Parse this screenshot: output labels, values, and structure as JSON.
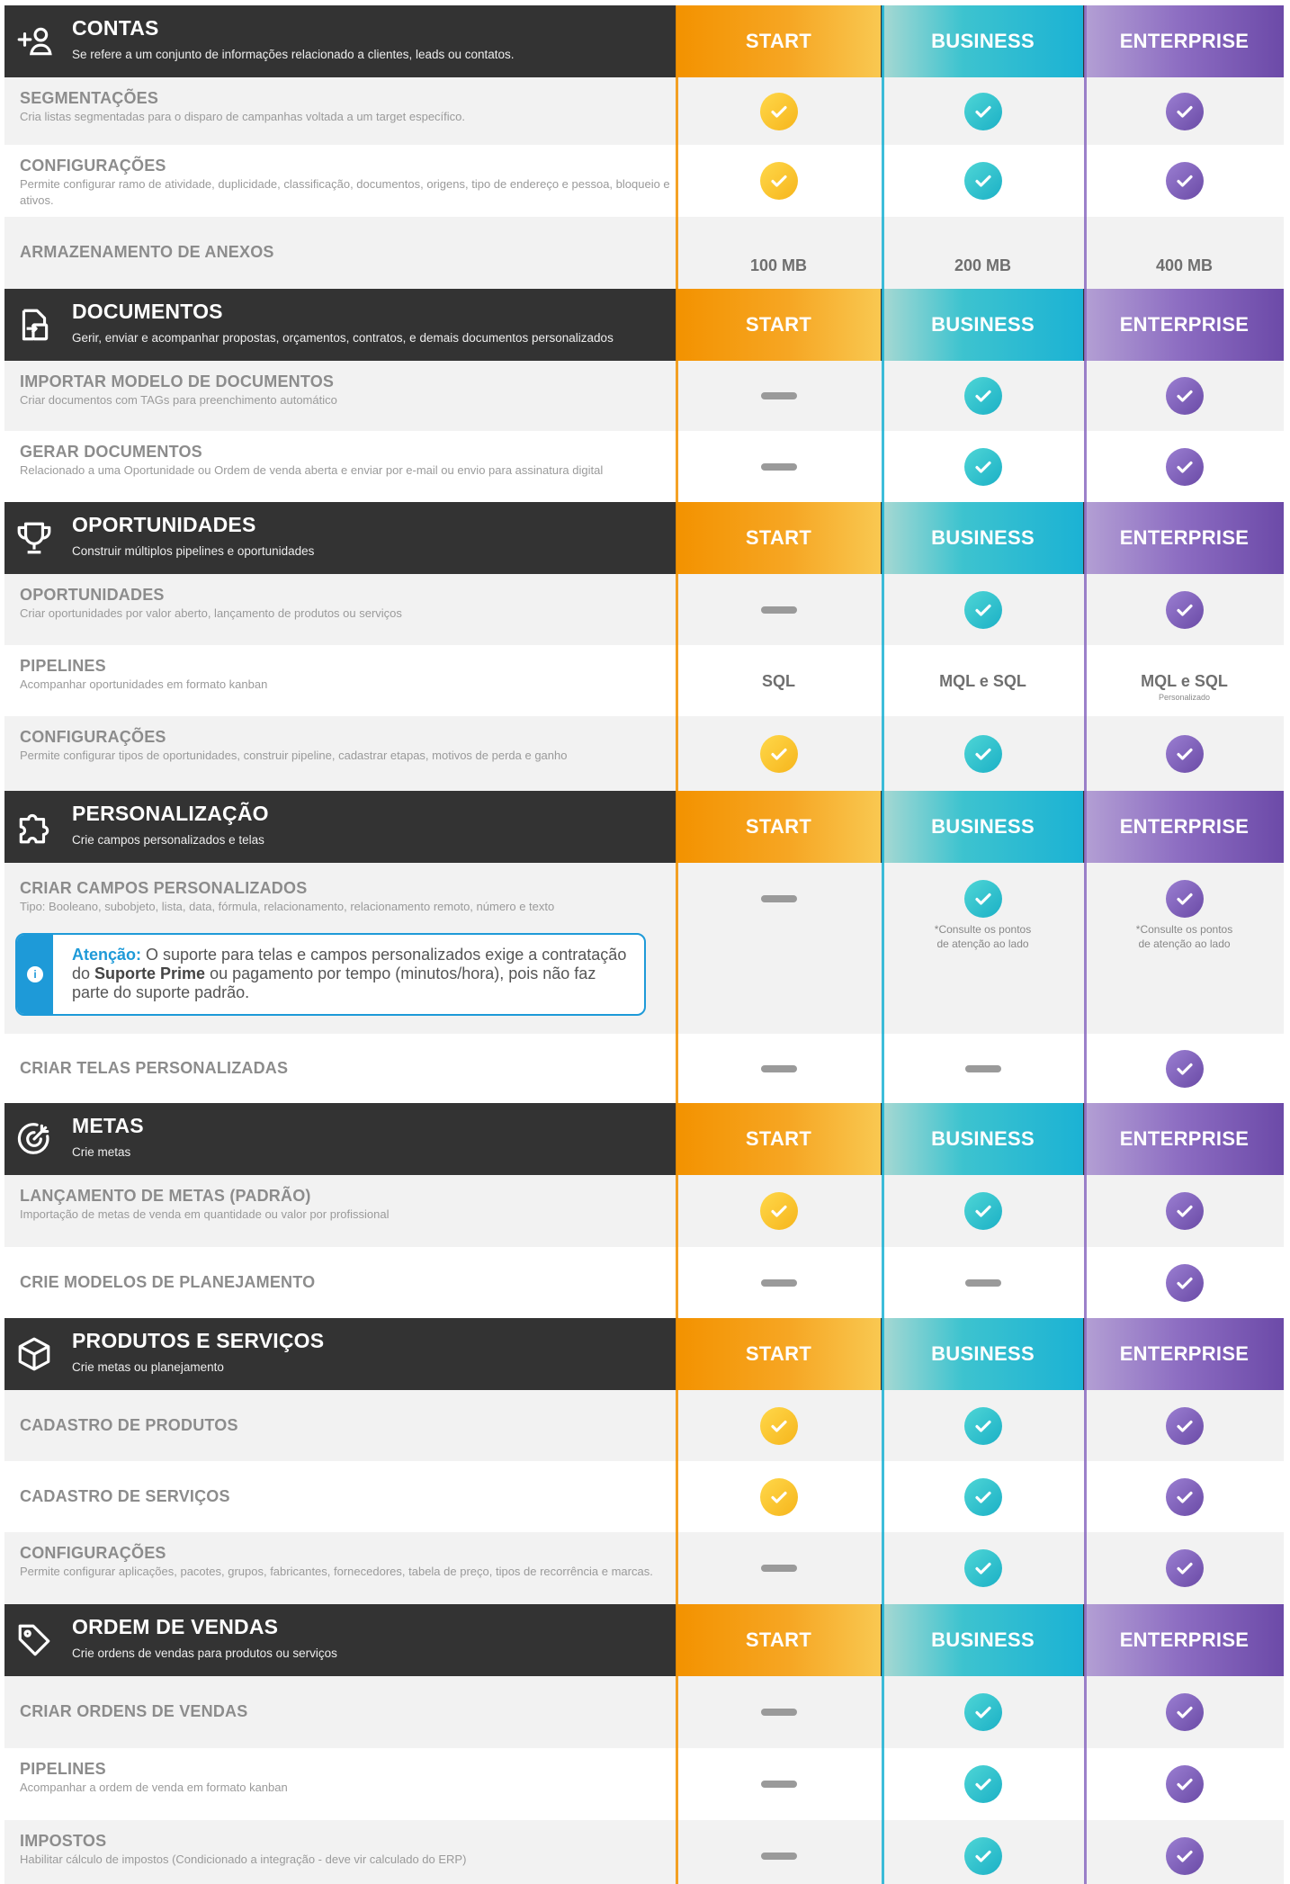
{
  "plans": [
    "START",
    "BUSINESS",
    "ENTERPRISE"
  ],
  "colors": {
    "start": "#f39200",
    "business": "#1bb2d4",
    "enterprise": "#6c4aa8",
    "header_bg": "#333333"
  },
  "sections": [
    {
      "icon": "add-user-icon",
      "title": "CONTAS",
      "subtitle": "Se refere a um conjunto de informações relacionado a clientes, leads ou contatos.",
      "features": [
        {
          "name": "SEGMENTAÇÕES",
          "desc": "Cria listas segmentadas para o disparo de campanhas voltada a um target específico.",
          "values": [
            "check",
            "check",
            "check"
          ]
        },
        {
          "name": "CONFIGURAÇÕES",
          "desc": "Permite configurar ramo de atividade, duplicidade, classificação, documentos, origens, tipo de endereço e pessoa, bloqueio e ativos.",
          "values": [
            "check",
            "check",
            "check"
          ]
        },
        {
          "name": "ARMAZENAMENTO DE ANEXOS",
          "desc": "",
          "values": [
            "100 MB",
            "200 MB",
            "400 MB"
          ]
        }
      ]
    },
    {
      "icon": "document-transfer-icon",
      "title": "DOCUMENTOS",
      "subtitle": "Gerir, enviar e acompanhar propostas, orçamentos, contratos, e demais documentos personalizados",
      "features": [
        {
          "name": "IMPORTAR MODELO DE DOCUMENTOS",
          "desc": "Criar documentos com TAGs para preenchimento automático",
          "values": [
            "dash",
            "check",
            "check"
          ]
        },
        {
          "name": "GERAR DOCUMENTOS",
          "desc": "Relacionado a uma Oportunidade ou Ordem de venda aberta e enviar por e-mail ou envio para assinatura digital",
          "values": [
            "dash",
            "check",
            "check"
          ]
        }
      ]
    },
    {
      "icon": "trophy-icon",
      "title": "OPORTUNIDADES",
      "subtitle": "Construir múltiplos pipelines e oportunidades",
      "features": [
        {
          "name": "OPORTUNIDADES",
          "desc": "Criar oportunidades por valor aberto, lançamento de produtos ou serviços",
          "values": [
            "dash",
            "check",
            "check"
          ]
        },
        {
          "name": "PIPELINES",
          "desc": "Acompanhar oportunidades em formato kanban",
          "values": [
            "SQL",
            "MQL e SQL",
            "MQL e SQL"
          ],
          "enterprise_note": "Personalizado"
        },
        {
          "name": "CONFIGURAÇÕES",
          "desc": "Permite configurar tipos de oportunidades, construir pipeline, cadastrar etapas, motivos de perda e ganho",
          "values": [
            "check",
            "check",
            "check"
          ]
        }
      ]
    },
    {
      "icon": "puzzle-icon",
      "title": "PERSONALIZAÇÃO",
      "subtitle": "Crie campos personalizados e telas",
      "features": [
        {
          "name": "CRIAR CAMPOS PERSONALIZADOS",
          "desc": "Tipo: Booleano, subobjeto, lista, data, fórmula, relacionamento, relacionamento remoto, número e texto",
          "values": [
            "dash",
            "check",
            "check"
          ],
          "note": "*Consulte os pontos\nde atenção ao lado"
        },
        {
          "name": "CRIAR TELAS PERSONALIZADAS",
          "desc": "",
          "values": [
            "dash",
            "dash",
            "check"
          ]
        }
      ],
      "alert": {
        "label": "Atenção:",
        "text_1": " O suporte para telas e campos personalizados exige a contratação do ",
        "bold": "Suporte Prime",
        "text_2": " ou pagamento por tempo (minutos/hora), pois não faz parte do suporte padrão."
      }
    },
    {
      "icon": "target-icon",
      "title": "METAS",
      "subtitle": "Crie metas",
      "features": [
        {
          "name": "LANÇAMENTO DE METAS (PADRÃO)",
          "desc": "Importação de metas de venda em quantidade ou valor por profissional",
          "values": [
            "check",
            "check",
            "check"
          ]
        },
        {
          "name": "CRIE MODELOS DE PLANEJAMENTO",
          "desc": "",
          "values": [
            "dash",
            "dash",
            "check"
          ]
        }
      ]
    },
    {
      "icon": "box-icon",
      "title": "PRODUTOS E SERVIÇOS",
      "subtitle": "Crie metas ou planejamento",
      "features": [
        {
          "name": "CADASTRO DE PRODUTOS",
          "desc": "",
          "values": [
            "check",
            "check",
            "check"
          ]
        },
        {
          "name": "CADASTRO DE SERVIÇOS",
          "desc": "",
          "values": [
            "check",
            "check",
            "check"
          ]
        },
        {
          "name": "CONFIGURAÇÕES",
          "desc": "Permite configurar aplicações, pacotes, grupos, fabricantes, fornecedores, tabela de preço, tipos de recorrência e marcas.",
          "values": [
            "dash",
            "check",
            "check"
          ]
        }
      ]
    },
    {
      "icon": "tag-icon",
      "title": "ORDEM DE VENDAS",
      "subtitle": "Crie ordens de vendas para produtos ou serviços",
      "features": [
        {
          "name": "CRIAR ORDENS DE VENDAS",
          "desc": "",
          "values": [
            "dash",
            "check",
            "check"
          ]
        },
        {
          "name": "PIPELINES",
          "desc": "Acompanhar a ordem de venda em formato kanban",
          "values": [
            "dash",
            "check",
            "check"
          ]
        },
        {
          "name": "IMPOSTOS",
          "desc": "Habilitar cálculo de impostos (Condicionado a integração - deve vir calculado do ERP)",
          "values": [
            "dash",
            "check",
            "check"
          ]
        }
      ]
    }
  ]
}
